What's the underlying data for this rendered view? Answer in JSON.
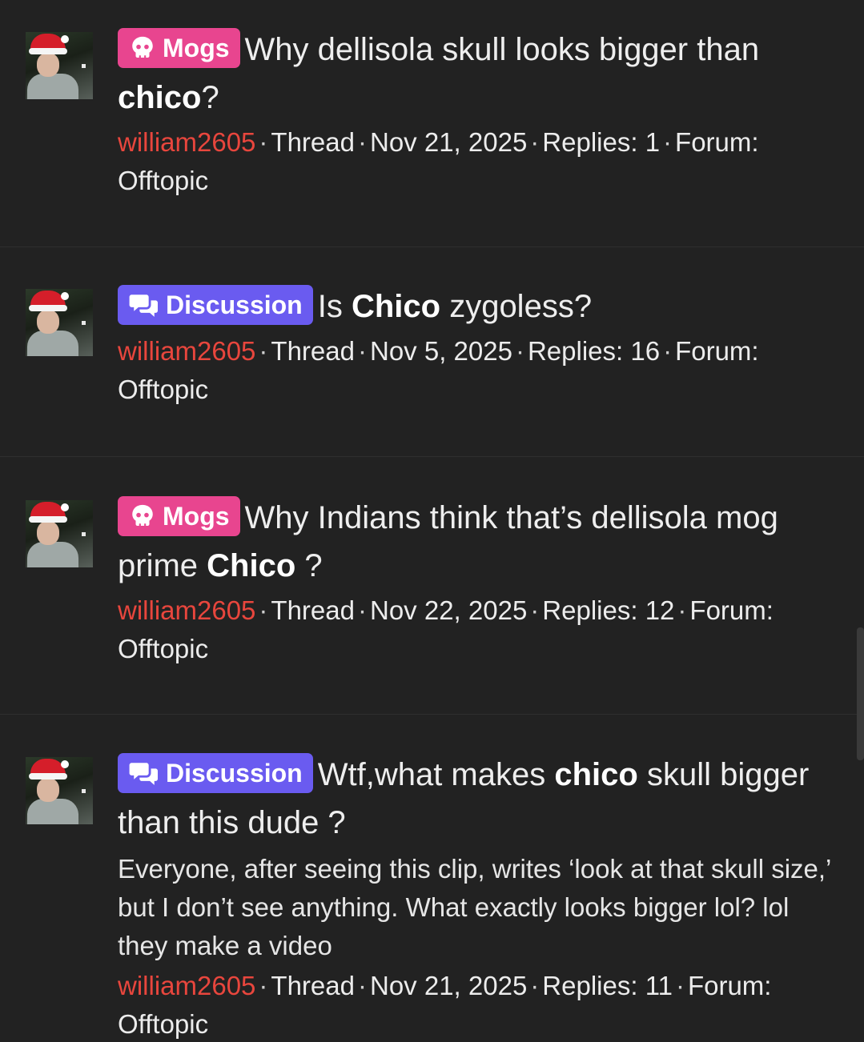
{
  "threads": [
    {
      "prefix": "Mogs",
      "prefix_color": "#e8458f",
      "prefix_icon": "skull-icon",
      "title_parts": [
        "Why dellisola skull looks bigger than ",
        "chico",
        "?"
      ],
      "author": "william2605",
      "type": "Thread",
      "date": "Nov 21, 2025",
      "replies": "Replies: 1",
      "forum": "Forum: Offtopic"
    },
    {
      "prefix": "Discussion",
      "prefix_color": "#6a5bf0",
      "prefix_icon": "chat-bubbles-icon",
      "title_parts": [
        "Is ",
        "Chico",
        " zygoless?"
      ],
      "author": "william2605",
      "type": "Thread",
      "date": "Nov 5, 2025",
      "replies": "Replies: 16",
      "forum": "Forum: Offtopic"
    },
    {
      "prefix": "Mogs",
      "prefix_color": "#e8458f",
      "prefix_icon": "skull-icon",
      "title_parts": [
        "Why Indians think that’s dellisola mog prime ",
        "Chico",
        " ?"
      ],
      "author": "william2605",
      "type": "Thread",
      "date": "Nov 22, 2025",
      "replies": "Replies: 12",
      "forum": "Forum: Offtopic"
    },
    {
      "prefix": "Discussion",
      "prefix_color": "#6a5bf0",
      "prefix_icon": "chat-bubbles-icon",
      "title_parts": [
        "Wtf,what makes ",
        "chico",
        " skull bigger than this dude ?"
      ],
      "snippet": "Everyone, after seeing this clip, writes ‘look at that skull size,’ but I don’t see anything. What exactly looks bigger lol? lol they make a video",
      "author": "william2605",
      "type": "Thread",
      "date": "Nov 21, 2025",
      "replies": "Replies: 11",
      "forum": "Forum: Offtopic"
    }
  ],
  "separator": "·"
}
